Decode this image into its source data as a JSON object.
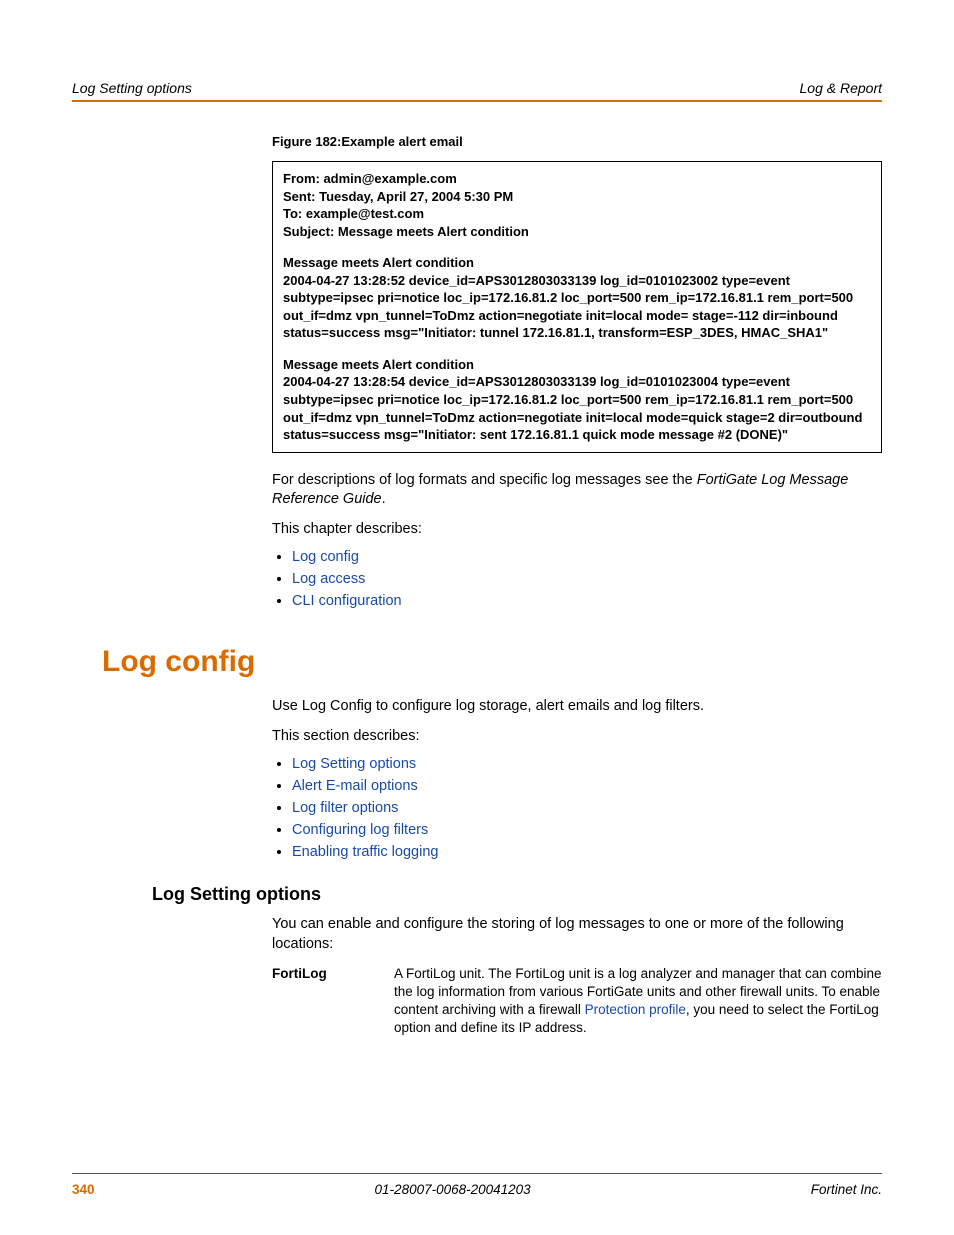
{
  "header": {
    "left": "Log Setting options",
    "right": "Log & Report"
  },
  "figure": {
    "caption": "Figure 182:Example alert email",
    "from": "From: admin@example.com",
    "sent": "Sent: Tuesday, April 27, 2004 5:30 PM",
    "to": "To: example@test.com",
    "subject": "Subject: Message meets Alert condition",
    "msg1a": "Message meets Alert condition",
    "msg1b": "2004-04-27 13:28:52 device_id=APS3012803033139 log_id=0101023002 type=event subtype=ipsec pri=notice loc_ip=172.16.81.2 loc_port=500 rem_ip=172.16.81.1 rem_port=500 out_if=dmz vpn_tunnel=ToDmz action=negotiate init=local mode= stage=-112 dir=inbound status=success msg=\"Initiator: tunnel 172.16.81.1, transform=ESP_3DES, HMAC_SHA1\"",
    "msg2a": "Message meets Alert condition",
    "msg2b": "2004-04-27 13:28:54 device_id=APS3012803033139 log_id=0101023004 type=event subtype=ipsec pri=notice loc_ip=172.16.81.2 loc_port=500 rem_ip=172.16.81.1 rem_port=500 out_if=dmz vpn_tunnel=ToDmz action=negotiate init=local mode=quick stage=2 dir=outbound status=success msg=\"Initiator: sent 172.16.81.1 quick mode message #2 (DONE)\""
  },
  "body": {
    "p1a": "For descriptions of log formats and specific log messages see the ",
    "p1b": "FortiGate Log Message Reference Guide",
    "p1c": ".",
    "p2": "This chapter describes:",
    "bullets1": [
      "Log config",
      "Log access",
      "CLI configuration"
    ],
    "h1": "Log config",
    "p3": "Use Log Config to configure log storage, alert emails and log filters.",
    "p4": "This section describes:",
    "bullets2": [
      "Log Setting options",
      "Alert E-mail options",
      "Log filter options",
      "Configuring log filters",
      "Enabling traffic logging"
    ],
    "h2": "Log Setting options",
    "p5": "You can enable and configure the storing of log messages to one or more of the following locations:",
    "def_term": "FortiLog",
    "def_a": "A FortiLog unit. The FortiLog unit is a log analyzer and manager that can combine the log information from various FortiGate units and other firewall units. To enable content archiving with a firewall ",
    "def_link": "Protection profile",
    "def_b": ", you need to select the FortiLog option and define its IP address."
  },
  "footer": {
    "page": "340",
    "docid": "01-28007-0068-20041203",
    "company": "Fortinet Inc."
  }
}
